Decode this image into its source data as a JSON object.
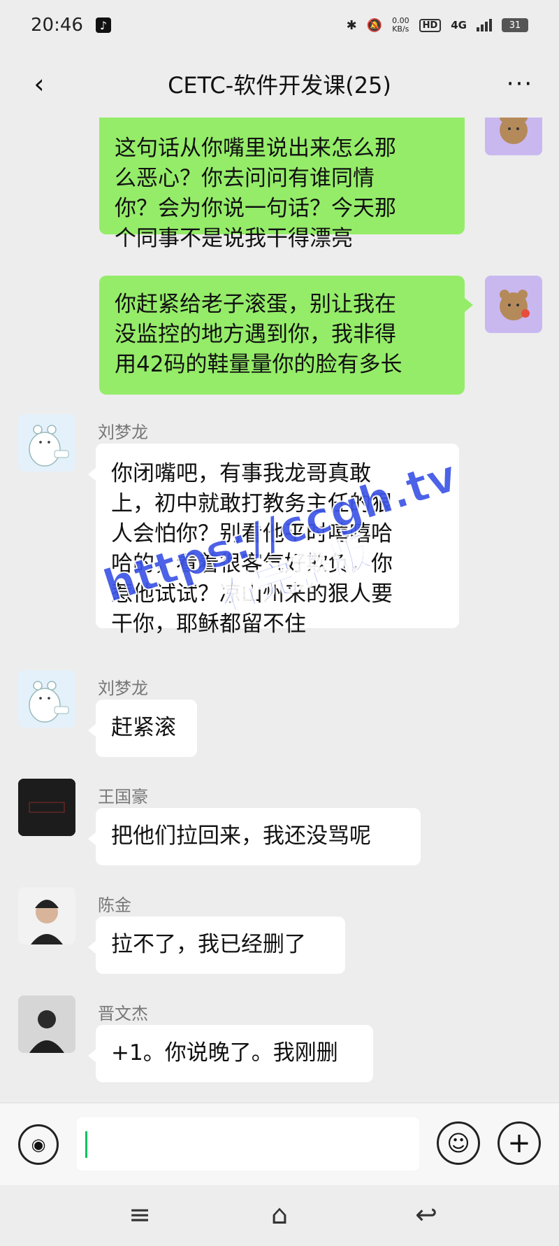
{
  "status_bar": {
    "time": "20:46",
    "app_icon": "tiktok-icon",
    "net_speed_value": "0.00",
    "net_speed_unit": "KB/s",
    "hd": "HD",
    "network": "4G",
    "battery": "31"
  },
  "header": {
    "title": "CETC-软件开发课(25)",
    "back_icon": "chevron-left-icon",
    "more_icon": "more-icon"
  },
  "messages": [
    {
      "side": "me",
      "text_lines": [
        "这句话从你嘴里说出来怎么那",
        "么恶心？你去问问有谁同情",
        "你？会为你说一句话？今天那",
        "个同事不是说我干得漂亮"
      ]
    },
    {
      "side": "me",
      "text_lines": [
        "你赶紧给老子滚蛋，别让我在",
        "没监控的地方遇到你，我非得",
        "用42码的鞋量量你的脸有多长"
      ]
    },
    {
      "side": "other",
      "sender": "刘梦龙",
      "text_lines": [
        "你闭嘴吧，有事我龙哥真敢",
        "上，初中就敢打教务主任的狠",
        "人会怕你？别看他平时嘻嘻哈",
        "哈的，看着很客气好欺负，你",
        "惹他试试？凉山州来的狠人要",
        "干你，耶稣都留不住"
      ]
    },
    {
      "side": "other",
      "sender": "刘梦龙",
      "text_lines": [
        "赶紧滚"
      ]
    },
    {
      "side": "other",
      "sender": "王国豪",
      "text_lines": [
        "把他们拉回来，我还没骂呢"
      ]
    },
    {
      "side": "other",
      "sender": "陈金",
      "text_lines": [
        "拉不了，我已经删了"
      ]
    },
    {
      "side": "other",
      "sender": "晋文杰",
      "text_lines": [
        "+1。你说晚了。我刚删"
      ]
    }
  ],
  "watermark": {
    "url": "https://ccgh.tv",
    "text": "看完整版"
  },
  "input_bar": {
    "voice_icon": "voice-icon",
    "emoji_icon": "emoji-icon",
    "plus_icon": "plus-icon",
    "value": ""
  },
  "nav_bar": {
    "menu_icon": "menu-icon",
    "home_icon": "home-icon",
    "back_icon": "back-icon"
  },
  "colors": {
    "background": "#ededed",
    "my_bubble": "#95ec69",
    "other_bubble": "#ffffff",
    "watermark": "#3d55e6",
    "caret": "#07c160"
  }
}
